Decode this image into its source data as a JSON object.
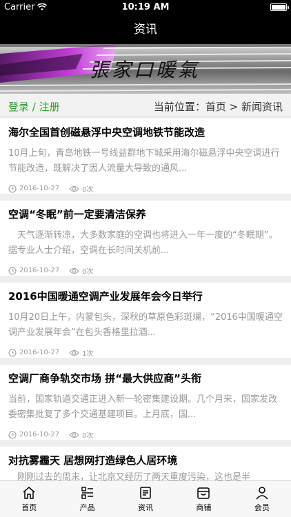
{
  "status_bar": {
    "carrier": "Carrier",
    "time": "10:19 AM"
  },
  "nav": {
    "title": "资讯"
  },
  "banner": {
    "text": "張家口暖氣"
  },
  "location": {
    "login": "登录",
    "separator": " / ",
    "register": "注册",
    "label": "当前位置：",
    "home": "首页",
    "arrow": " > ",
    "current": "新闻资讯"
  },
  "articles": [
    {
      "title": "海尔全国首创磁悬浮中央空调地铁节能改造",
      "summary": "10月上旬，青岛地铁一号线益群地下城采用海尔磁悬浮中央空调进行节能改造，既解决了因人流量大导致的通风...",
      "date": "2016-10-27",
      "views": "0次"
    },
    {
      "title": "空调“冬眠”前一定要清洁保养",
      "summary": "　天气逐渐转凉，大多数家庭的空调也将进入一年一度的“冬眠期”。　据专业人士介绍，空调在长时间关机前...",
      "date": "2016-10-27",
      "views": "0次"
    },
    {
      "title": "2016中国暖通空调产业发展年会今日举行",
      "summary": "10月20日上午，内蒙包头，深秋的草原色彩斑斓，“2016中国暖通空调产业发展年会”在包头香格里拉酒...",
      "date": "2016-10-27",
      "views": "1次"
    },
    {
      "title": "空调厂商争轨交市场 拼“最大供应商”头衔",
      "summary": "当前，国家轨道交通正进入新一轮密集建设期。几个月来，国家发改委密集批复了多个交通基建项目。上月底，国...",
      "date": "2016-10-27",
      "views": "0次"
    },
    {
      "title": "对抗雾霾天 居想网打造绿色人居环境",
      "summary": "　刚刚过去的周末，让北京又经历了两天重度污染，这也是半",
      "date": "",
      "views": ""
    }
  ],
  "tabbar": {
    "items": [
      {
        "label": "首页",
        "icon": "home-icon"
      },
      {
        "label": "产品",
        "icon": "list-icon"
      },
      {
        "label": "资讯",
        "icon": "news-icon"
      },
      {
        "label": "商铺",
        "icon": "shop-icon"
      },
      {
        "label": "会员",
        "icon": "user-icon"
      }
    ],
    "active_index": 2
  },
  "colors": {
    "accent_green": "#2e9e31",
    "bar_black": "#000000",
    "muted_text": "#999999"
  }
}
